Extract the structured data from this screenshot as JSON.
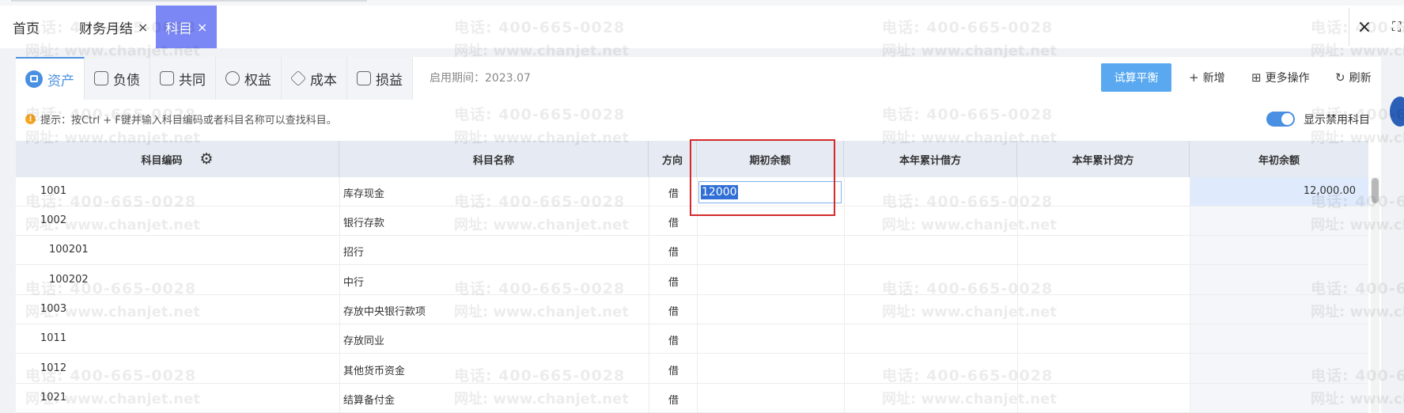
{
  "tabs": [
    {
      "label": "首页",
      "closable": false
    },
    {
      "label": "财务月结",
      "closable": true
    },
    {
      "label": "科目",
      "closable": true,
      "active": true
    }
  ],
  "close_glyph": "×",
  "category_tabs": [
    {
      "label": "资产",
      "icon": "asset-icon",
      "active": true
    },
    {
      "label": "负债",
      "icon": "liability-icon"
    },
    {
      "label": "共同",
      "icon": "common-icon"
    },
    {
      "label": "权益",
      "icon": "equity-icon"
    },
    {
      "label": "成本",
      "icon": "cost-icon"
    },
    {
      "label": "损益",
      "icon": "profit-loss-icon"
    }
  ],
  "period": "启用期间：2023.07",
  "toolbar": {
    "trial_balance": "试算平衡",
    "add": "新增",
    "more": "更多操作",
    "refresh": "刷新"
  },
  "tip": {
    "icon": "!",
    "text": "提示：按Ctrl + F键并输入科目编码或者科目名称可以查找科目。"
  },
  "show_disabled": {
    "label": "显示禁用科目",
    "checked": true
  },
  "columns": [
    "科目编码",
    "科目名称",
    "方向",
    "期初余额",
    "本年累计借方",
    "本年累计贷方",
    "年初余额"
  ],
  "rows": [
    {
      "code": "1001",
      "name": "库存现金",
      "dir": "借",
      "opening": "12000",
      "debit": "",
      "credit": "",
      "year_start": "12,000.00"
    },
    {
      "code": "1002",
      "name": "银行存款",
      "dir": "借",
      "opening": "",
      "debit": "",
      "credit": "",
      "year_start": ""
    },
    {
      "code": "100201",
      "name": "招行",
      "dir": "借",
      "opening": "",
      "debit": "",
      "credit": "",
      "year_start": ""
    },
    {
      "code": "100202",
      "name": "中行",
      "dir": "借",
      "opening": "",
      "debit": "",
      "credit": "",
      "year_start": ""
    },
    {
      "code": "1003",
      "name": "存放中央银行款项",
      "dir": "借",
      "opening": "",
      "debit": "",
      "credit": "",
      "year_start": ""
    },
    {
      "code": "1011",
      "name": "存放同业",
      "dir": "借",
      "opening": "",
      "debit": "",
      "credit": "",
      "year_start": ""
    },
    {
      "code": "1012",
      "name": "其他货币资金",
      "dir": "借",
      "opening": "",
      "debit": "",
      "credit": "",
      "year_start": ""
    },
    {
      "code": "1021",
      "name": "结算备付金",
      "dir": "借",
      "opening": "",
      "debit": "",
      "credit": "",
      "year_start": ""
    }
  ],
  "watermark": {
    "line1": "电话: 400-665-0028",
    "line2": "网址: www.chanjet.net"
  },
  "colors": {
    "accent": "#4a90e2",
    "active_tab": "#7b87f5",
    "highlight_box": "#d62a2a"
  }
}
